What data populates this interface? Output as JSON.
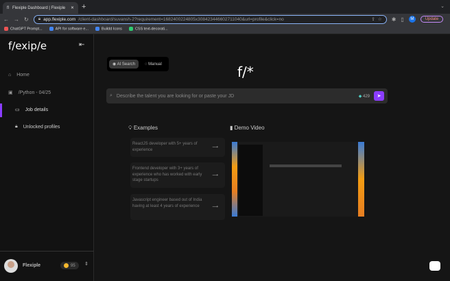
{
  "browser": {
    "tab_title": "Flexiple Dashboard | Flexiple",
    "url_host": "app.flexiple.com",
    "url_path": "/client-dashboard/suvansh-2?requirement=1682400224805x308423446602711040&url=profile&click=no",
    "profile_initial": "M",
    "update_label": "Update",
    "bookmarks": [
      {
        "label": "ChatGPT Prompt...",
        "color": "#e55"
      },
      {
        "label": "API for software e...",
        "color": "#4285f4"
      },
      {
        "label": "Buildd Icons",
        "color": "#4285f4"
      },
      {
        "label": "CSS text-decorati...",
        "color": "#2ecc71"
      }
    ]
  },
  "sidebar": {
    "logo": "f/exip/e",
    "items": [
      {
        "label": "Home"
      },
      {
        "label": "/Python - 04/25"
      },
      {
        "label": "Job details"
      },
      {
        "label": "Unlocked profiles"
      }
    ],
    "user": "Flexiple",
    "coins": "95"
  },
  "main": {
    "toggle": {
      "ai": "AI Search",
      "manual": "Manual"
    },
    "logo": "f/*",
    "search_placeholder": "Describe the talent you are looking for or paste your JD",
    "credits": "429",
    "examples_title": "Examples",
    "demo_title": "Demo Video",
    "examples": [
      "ReactJS developer with 5+ years of experience",
      "Frontend developer with 3+ years of experience who has worked with early stage startups",
      "Javascript engineer based out of India having at least 4 years of experience"
    ]
  },
  "colors": {
    "accent": "#8b3dff"
  }
}
